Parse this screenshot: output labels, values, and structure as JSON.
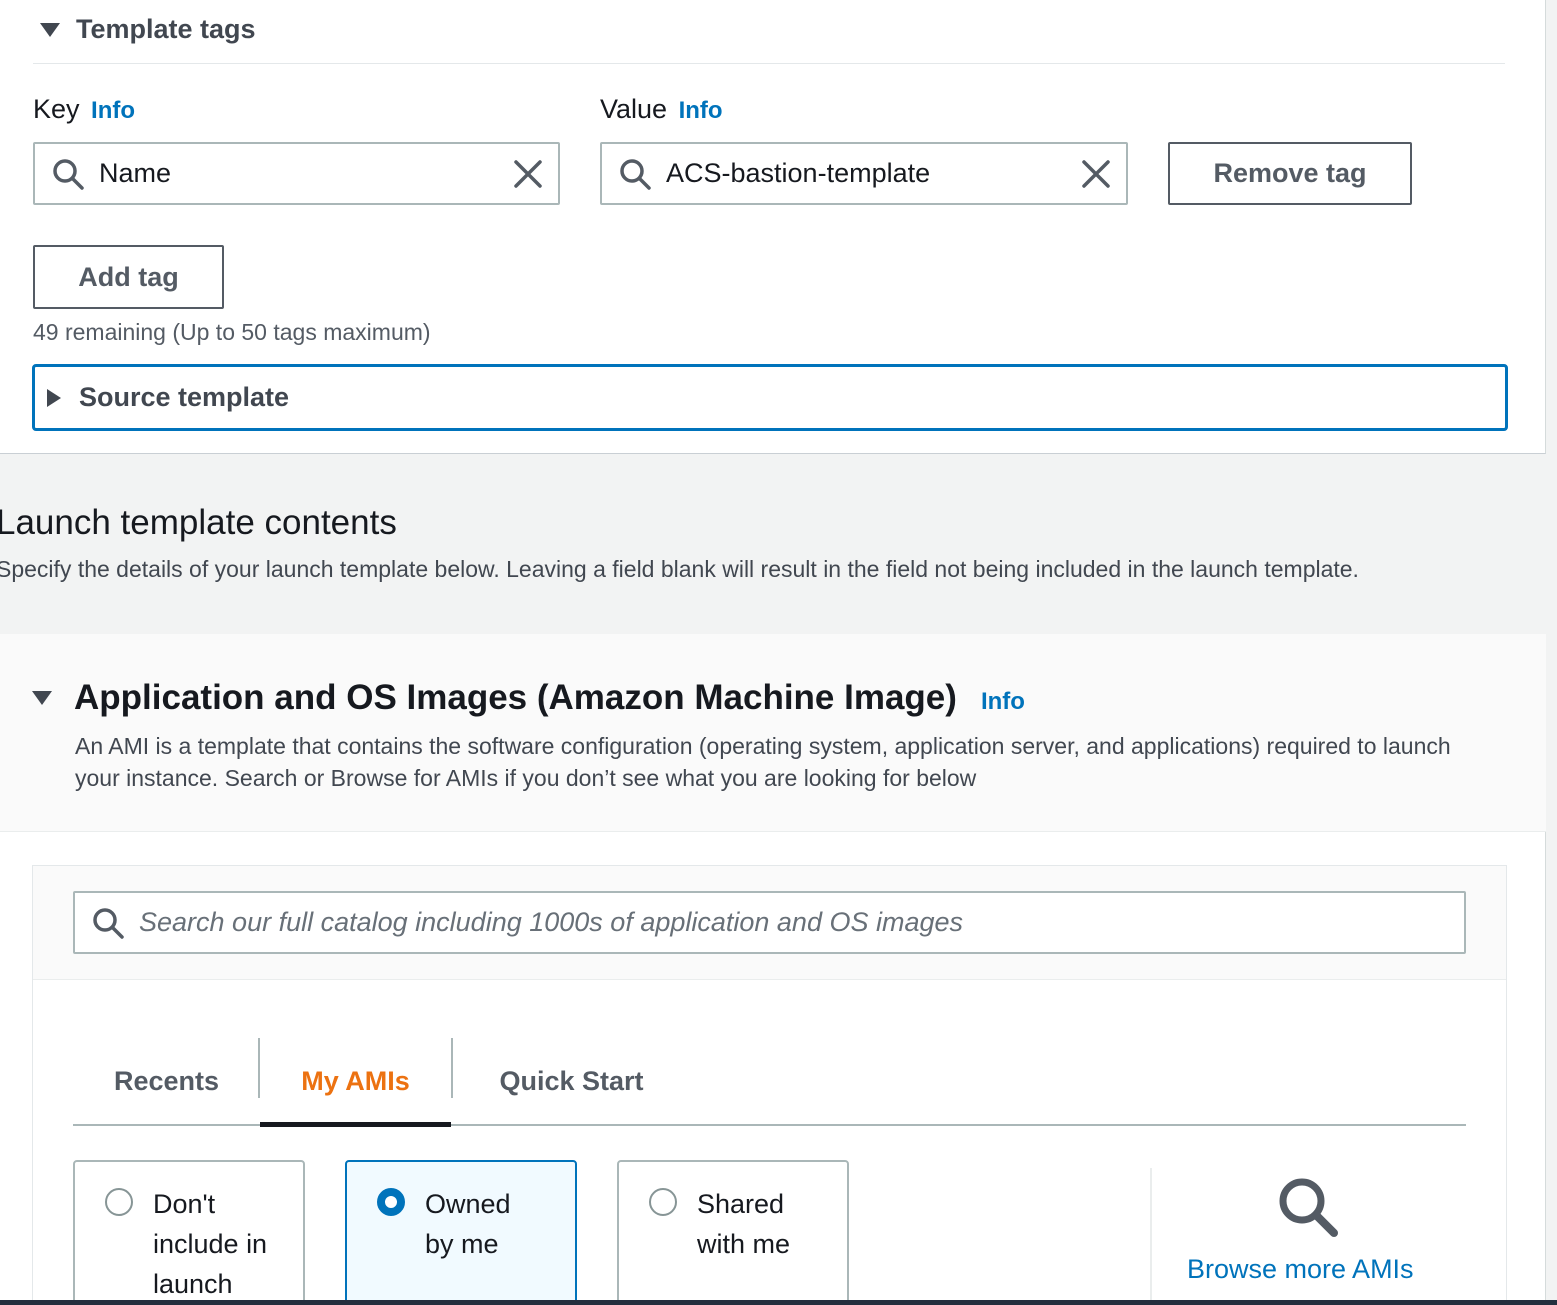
{
  "template_tags": {
    "title": "Template tags",
    "key_label": "Key",
    "value_label": "Value",
    "info": "Info",
    "tag": {
      "key": "Name",
      "value": "ACS-bastion-template"
    },
    "remove_tag_label": "Remove tag",
    "add_tag_label": "Add tag",
    "remaining_text": "49 remaining (Up to 50 tags maximum)"
  },
  "source_template": {
    "label": "Source template"
  },
  "launch_template_contents": {
    "title": "Launch template contents",
    "description": "Specify the details of your launch template below. Leaving a field blank will result in the field not being included in the launch template."
  },
  "ami_section": {
    "title": "Application and OS Images (Amazon Machine Image)",
    "info": "Info",
    "description": "An AMI is a template that contains the software configuration (operating system, application server, and applications) required to launch your instance. Search or Browse for AMIs if you don’t see what you are looking for below",
    "search_placeholder": "Search our full catalog including 1000s of application and OS images",
    "tabs": [
      {
        "label": "Recents",
        "active": false
      },
      {
        "label": "My AMIs",
        "active": true
      },
      {
        "label": "Quick Start",
        "active": false
      }
    ],
    "options": [
      {
        "label": "Don't include in launch",
        "selected": false
      },
      {
        "label": "Owned by me",
        "selected": true
      },
      {
        "label": "Shared with me",
        "selected": false
      }
    ],
    "browse_more": "Browse more AMIs"
  },
  "colors": {
    "link": "#0073bb",
    "active_tab": "#ec7211",
    "focus_border": "#0073bb"
  },
  "icons": [
    "caret-down-icon",
    "caret-right-icon",
    "search-icon",
    "clear-icon"
  ]
}
